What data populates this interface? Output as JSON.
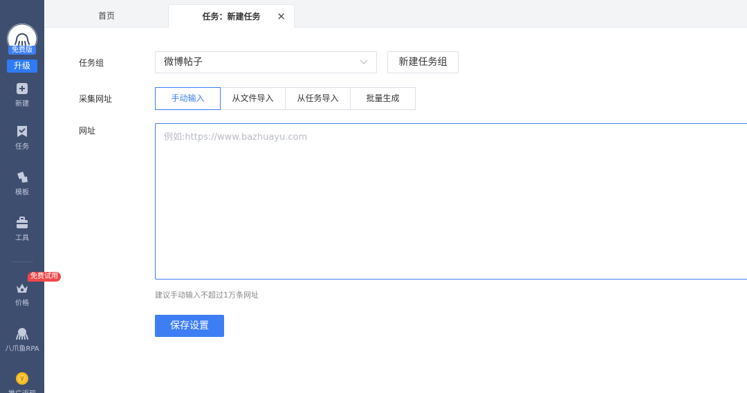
{
  "sidebar": {
    "avatar_badge": "免费版",
    "upgrade_label": "升级",
    "items": [
      {
        "label": "新建",
        "icon": "plus-square-icon"
      },
      {
        "label": "任务",
        "icon": "task-check-icon"
      },
      {
        "label": "模板",
        "icon": "template-icon"
      },
      {
        "label": "工具",
        "icon": "toolbox-icon"
      },
      {
        "label": "价格",
        "icon": "crown-icon"
      },
      {
        "label": "八爪鱼RPA",
        "icon": "octopus-icon"
      },
      {
        "label": "推广返现",
        "icon": "coin-icon"
      }
    ],
    "trial_badge": "免费试用",
    "colors": {
      "bg": "#3e4e6e",
      "accent": "#2f7bf5",
      "badge": "#f0484a"
    }
  },
  "tabs": {
    "home": "首页",
    "active": "任务：新建任务",
    "close_glyph": "✕"
  },
  "form": {
    "task_group_label": "任务组",
    "task_group_value": "微博帖子",
    "new_group_button": "新建任务组",
    "collect_url_label": "采集网址",
    "modes": [
      "手动输入",
      "从文件导入",
      "从任务导入",
      "批量生成"
    ],
    "active_mode": "手动输入",
    "url_label": "网址",
    "url_placeholder": "例如:https://www.bazhuayu.com",
    "hint": "建议手动输入不超过1万条网址",
    "save_button": "保存设置",
    "accent_color": "#3d7ef4"
  }
}
